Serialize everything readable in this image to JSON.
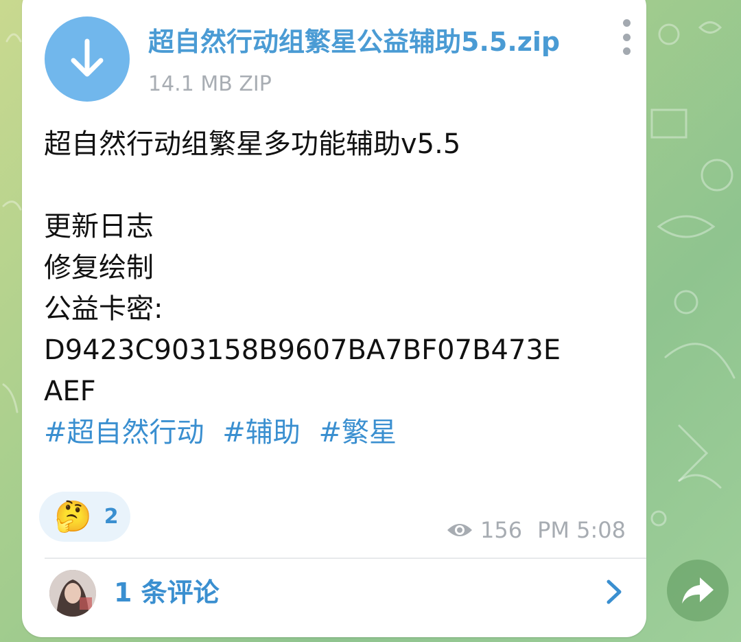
{
  "file": {
    "name": "超自然行动组繁星公益辅助5.5.zip",
    "meta": "14.1 MB ZIP",
    "download_icon": "arrow-down-icon"
  },
  "message": {
    "lines": [
      "超自然行动组繁星多功能辅助v5.5",
      "",
      "更新日志",
      "修复绘制",
      "公益卡密:",
      "D9423C903158B9607BA7BF07B473E",
      "AEF"
    ],
    "hashtags": [
      "#超自然行动",
      "#辅助",
      "#繁星"
    ]
  },
  "reaction": {
    "emoji": "🤔",
    "count": "2"
  },
  "meta": {
    "views": "156",
    "time": "PM 5:08"
  },
  "comments": {
    "label": "1 条评论"
  },
  "colors": {
    "accent": "#3a8fd0",
    "download_bg": "#71b7ec",
    "meta_gray": "#a7acb2",
    "share_bg": "#5a965a"
  }
}
